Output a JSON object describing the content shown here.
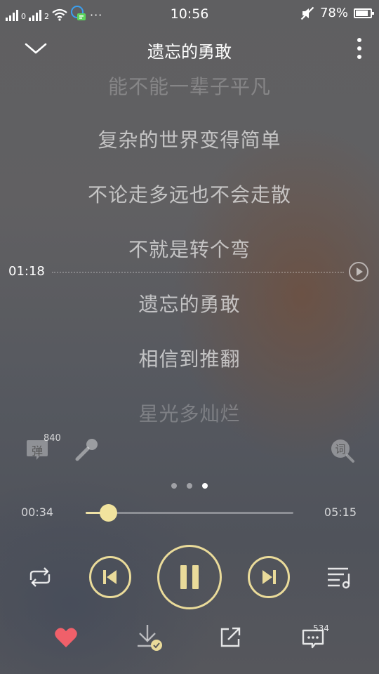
{
  "status_bar": {
    "sim1_label": "0",
    "sim2_label": "2",
    "time": "10:56",
    "battery": "78%"
  },
  "header": {
    "title": "遗忘的勇敢"
  },
  "lyrics": [
    "能不能一辈子平凡",
    "复杂的世界变得简单",
    "不论走多远也不会走散",
    "不就是转个弯",
    "遗忘的勇敢",
    "相信到推翻",
    "星光多灿烂"
  ],
  "seek_preview": {
    "time": "01:18"
  },
  "tools": {
    "danmu_label": "弹",
    "danmu_count": "840",
    "lyrics_search_label": "词"
  },
  "pager": {
    "pages": 3,
    "active_index": 2
  },
  "progress": {
    "current": "00:34",
    "total": "05:15",
    "fraction": 0.108
  },
  "bottom_bar": {
    "comment_count": "534"
  },
  "colors": {
    "accent": "#eadb9a",
    "like": "#f0606a"
  }
}
